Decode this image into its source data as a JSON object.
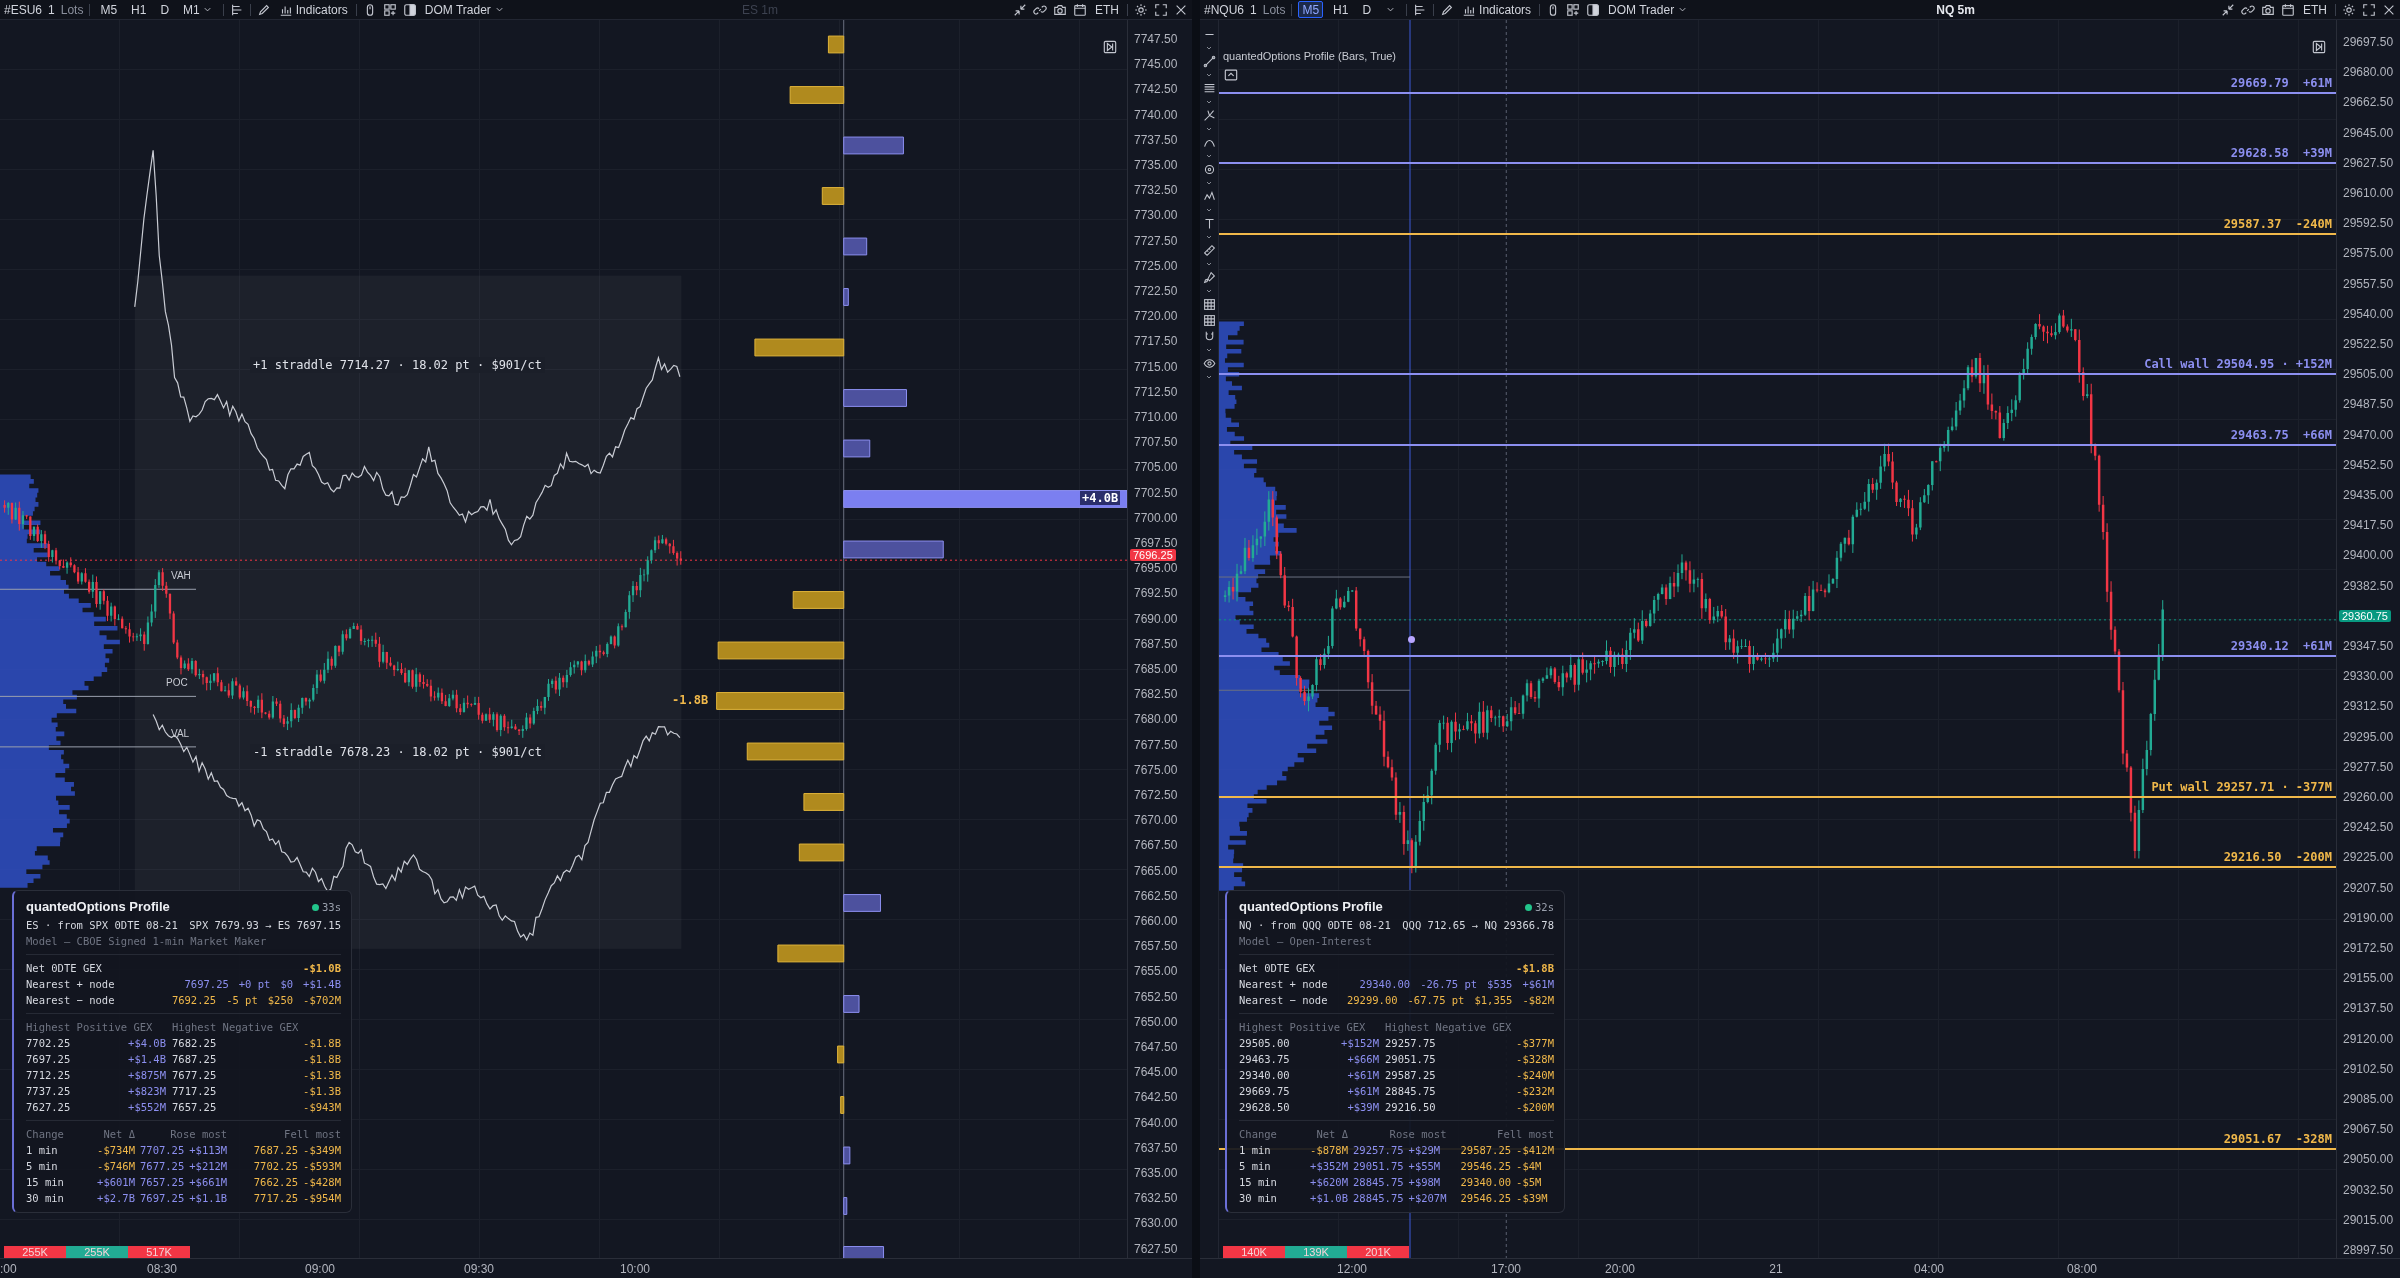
{
  "panes": [
    {
      "toolbar": {
        "symbol": "#ESU6",
        "qty": "1",
        "qty_unit": "Lots",
        "timeframes": [
          {
            "label": "M5",
            "selected": false
          },
          {
            "label": "H1",
            "selected": false
          },
          {
            "label": "D",
            "selected": false
          }
        ],
        "timeframe_menu": "M1",
        "indicators": "Indicators",
        "dom": "DOM Trader",
        "title": "ES 1m",
        "title_dimmed": true,
        "session": "ETH"
      },
      "straddles": [
        "+1 straddle 7714.27 · 18.02 pt · $901/ct",
        "-1 straddle 7678.23 · 18.02 pt · $901/ct"
      ],
      "profile_levels": [
        "VAH",
        "POC",
        "VAL"
      ],
      "gex_labels": [
        {
          "text": "+4.0B",
          "negative": false
        },
        {
          "text": "-1.8B",
          "negative": true
        }
      ],
      "price_axis": {
        "labels": [
          "7747.50",
          "7745.00",
          "7742.50",
          "7740.00",
          "7737.50",
          "7735.00",
          "7732.50",
          "7730.00",
          "7727.50",
          "7725.00",
          "7722.50",
          "7720.00",
          "7717.50",
          "7715.00",
          "7712.50",
          "7710.00",
          "7707.50",
          "7705.00",
          "7702.50",
          "7700.00",
          "7697.50",
          "7695.00",
          "7692.50",
          "7690.00",
          "7687.50",
          "7685.00",
          "7682.50",
          "7680.00",
          "7677.50",
          "7675.00",
          "7672.50",
          "7670.00",
          "7667.50",
          "7665.00",
          "7662.50",
          "7660.00",
          "7657.50",
          "7655.00",
          "7652.50",
          "7650.00",
          "7647.50",
          "7645.00",
          "7642.50",
          "7640.00",
          "7637.50",
          "7635.00",
          "7632.50",
          "7630.00",
          "7627.50"
        ],
        "current": {
          "label": "7696.25",
          "rising": false
        }
      },
      "time_axis": [
        ":00",
        "08:30",
        "09:00",
        "09:30",
        "10:00"
      ],
      "volume_bars": [
        {
          "label": "255K",
          "color": "#f23645"
        },
        {
          "label": "255K",
          "color": "#22ab94"
        },
        {
          "label": "517K",
          "color": "#f23645"
        }
      ],
      "panel": {
        "title": "quantedOptions Profile",
        "age": "33s",
        "source": "ES · from SPX 0DTE 08-21",
        "conversion": "SPX 7679.93 → ES 7697.15",
        "model": "Model — CBOE Signed 1-min Market Maker",
        "net": {
          "label": "Net 0DTE GEX",
          "value": "-$1.0B",
          "negative": true
        },
        "nearest": [
          {
            "label": "Nearest + node",
            "strike": "7697.25",
            "distance": "+0 pt",
            "cost": "$0",
            "gex": "+$1.4B",
            "negative": false
          },
          {
            "label": "Nearest − node",
            "strike": "7692.25",
            "distance": "-5 pt",
            "cost": "$250",
            "gex": "-$702M",
            "negative": true
          }
        ],
        "highest_headers": [
          "Highest Positive GEX",
          "Highest Negative GEX"
        ],
        "highest": [
          {
            "pos_strike": "7702.25",
            "pos_gex": "+$4.0B",
            "neg_strike": "7682.25",
            "neg_gex": "-$1.8B"
          },
          {
            "pos_strike": "7697.25",
            "pos_gex": "+$1.4B",
            "neg_strike": "7687.25",
            "neg_gex": "-$1.8B"
          },
          {
            "pos_strike": "7712.25",
            "pos_gex": "+$875M",
            "neg_strike": "7677.25",
            "neg_gex": "-$1.3B"
          },
          {
            "pos_strike": "7737.25",
            "pos_gex": "+$823M",
            "neg_strike": "7717.25",
            "neg_gex": "-$1.3B"
          },
          {
            "pos_strike": "7627.25",
            "pos_gex": "+$552M",
            "neg_strike": "7657.25",
            "neg_gex": "-$943M"
          }
        ],
        "change_headers": [
          "Change",
          "Net Δ",
          "Rose most",
          "Fell most"
        ],
        "changes": [
          {
            "period": "1 min",
            "net": "-$734M",
            "negative": true,
            "rose_strike": "7707.25",
            "rose_gex": "+$113M",
            "fell_strike": "7687.25",
            "fell_gex": "-$349M"
          },
          {
            "period": "5 min",
            "net": "-$746M",
            "negative": true,
            "rose_strike": "7677.25",
            "rose_gex": "+$212M",
            "fell_strike": "7702.25",
            "fell_gex": "-$593M"
          },
          {
            "period": "15 min",
            "net": "+$601M",
            "negative": false,
            "rose_strike": "7657.25",
            "rose_gex": "+$661M",
            "fell_strike": "7662.25",
            "fell_gex": "-$428M"
          },
          {
            "period": "30 min",
            "net": "+$2.7B",
            "negative": false,
            "rose_strike": "7697.25",
            "rose_gex": "+$1.1B",
            "fell_strike": "7717.25",
            "fell_gex": "-$954M"
          }
        ]
      }
    },
    {
      "toolbar": {
        "symbol": "#NQU6",
        "qty": "1",
        "qty_unit": "Lots",
        "timeframes": [
          {
            "label": "M5",
            "selected": true
          },
          {
            "label": "H1",
            "selected": false
          },
          {
            "label": "D",
            "selected": false
          }
        ],
        "indicators": "Indicators",
        "dom": "DOM Trader",
        "title": "NQ 5m",
        "title_dimmed": false,
        "session": "ETH"
      },
      "indicator_label": "quantedOptions Profile (Bars, True)",
      "level_lines": [
        {
          "text": "29669.79  +61M",
          "kind": "call"
        },
        {
          "text": "29628.58  +39M",
          "kind": "call"
        },
        {
          "text": "29587.37  -240M",
          "kind": "put"
        },
        {
          "text": "Call wall 29504.95 · +152M",
          "kind": "call"
        },
        {
          "text": "29463.75  +66M",
          "kind": "call"
        },
        {
          "text": "29340.12  +61M",
          "kind": "call"
        },
        {
          "text": "Put wall 29257.71 · -377M",
          "kind": "put"
        },
        {
          "text": "29216.50  -200M",
          "kind": "put"
        },
        {
          "text": "29051.67  -328M",
          "kind": "put"
        }
      ],
      "price_axis": {
        "labels": [
          "29697.50",
          "29680.00",
          "29662.50",
          "29645.00",
          "29627.50",
          "29610.00",
          "29592.50",
          "29575.00",
          "29557.50",
          "29540.00",
          "29522.50",
          "29505.00",
          "29487.50",
          "29470.00",
          "29452.50",
          "29435.00",
          "29417.50",
          "29400.00",
          "29382.50",
          "29347.50",
          "29330.00",
          "29312.50",
          "29295.00",
          "29277.50",
          "29260.00",
          "29242.50",
          "29225.00",
          "29207.50",
          "29190.00",
          "29172.50",
          "29155.00",
          "29137.50",
          "29120.00",
          "29102.50",
          "29085.00",
          "29067.50",
          "29050.00",
          "29032.50",
          "29015.00",
          "28997.50"
        ],
        "current": {
          "label": "29360.75",
          "rising": true
        }
      },
      "time_axis": [
        "12:00",
        "17:00",
        "20:00",
        "21",
        "04:00",
        "08:00"
      ],
      "volume_bars": [
        {
          "label": "140K",
          "color": "#f23645"
        },
        {
          "label": "139K",
          "color": "#22ab94"
        },
        {
          "label": "201K",
          "color": "#f23645"
        }
      ],
      "panel": {
        "title": "quantedOptions Profile",
        "age": "32s",
        "source": "NQ · from QQQ 0DTE 08-21",
        "conversion": "QQQ 712.65 → NQ 29366.78",
        "model": "Model — Open-Interest",
        "net": {
          "label": "Net 0DTE GEX",
          "value": "-$1.8B",
          "negative": true
        },
        "nearest": [
          {
            "label": "Nearest + node",
            "strike": "29340.00",
            "distance": "-26.75 pt",
            "cost": "$535",
            "gex": "+$61M",
            "negative": false
          },
          {
            "label": "Nearest − node",
            "strike": "29299.00",
            "distance": "-67.75 pt",
            "cost": "$1,355",
            "gex": "-$82M",
            "negative": true
          }
        ],
        "highest_headers": [
          "Highest Positive GEX",
          "Highest Negative GEX"
        ],
        "highest": [
          {
            "pos_strike": "29505.00",
            "pos_gex": "+$152M",
            "neg_strike": "29257.75",
            "neg_gex": "-$377M"
          },
          {
            "pos_strike": "29463.75",
            "pos_gex": "+$66M",
            "neg_strike": "29051.75",
            "neg_gex": "-$328M"
          },
          {
            "pos_strike": "29340.00",
            "pos_gex": "+$61M",
            "neg_strike": "29587.25",
            "neg_gex": "-$240M"
          },
          {
            "pos_strike": "29669.75",
            "pos_gex": "+$61M",
            "neg_strike": "28845.75",
            "neg_gex": "-$232M"
          },
          {
            "pos_strike": "29628.50",
            "pos_gex": "+$39M",
            "neg_strike": "29216.50",
            "neg_gex": "-$200M"
          }
        ],
        "change_headers": [
          "Change",
          "Net Δ",
          "Rose most",
          "Fell most"
        ],
        "changes": [
          {
            "period": "1 min",
            "net": "-$878M",
            "negative": true,
            "rose_strike": "29257.75",
            "rose_gex": "+$29M",
            "fell_strike": "29587.25",
            "fell_gex": "-$412M"
          },
          {
            "period": "5 min",
            "net": "+$352M",
            "negative": false,
            "rose_strike": "29051.75",
            "rose_gex": "+$55M",
            "fell_strike": "29546.25",
            "fell_gex": "-$4M"
          },
          {
            "period": "15 min",
            "net": "+$620M",
            "negative": false,
            "rose_strike": "28845.75",
            "rose_gex": "+$98M",
            "fell_strike": "29340.00",
            "fell_gex": "-$5M"
          },
          {
            "period": "30 min",
            "net": "+$1.0B",
            "negative": false,
            "rose_strike": "28845.75",
            "rose_gex": "+$207M",
            "fell_strike": "29546.25",
            "fell_gex": "-$39M"
          }
        ]
      }
    }
  ]
}
